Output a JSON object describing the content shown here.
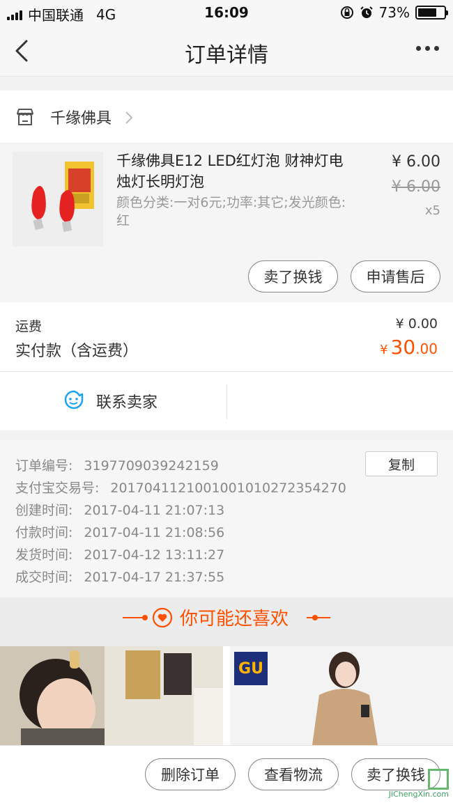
{
  "status_bar": {
    "carrier": "中国联通",
    "network": "4G",
    "time": "16:09",
    "battery": "73%",
    "battery_level": 0.73
  },
  "nav": {
    "title": "订单详情",
    "back_icon": "chevron-left-icon",
    "more_icon": "more-dots-icon"
  },
  "shop": {
    "name": "千缘佛具",
    "icon": "store-icon"
  },
  "product": {
    "name": "千缘佛具E12 LED红灯泡 财神灯电烛灯长明灯泡",
    "spec": "颜色分类:一对6元;功率:其它;发光颜色:红",
    "price": "¥ 6.00",
    "original_price": "¥ 6.00",
    "quantity": "x5",
    "actions": [
      "卖了换钱",
      "申请售后"
    ]
  },
  "fees": {
    "shipping_label": "运费",
    "shipping_value": "¥ 0.00",
    "paid_label": "实付款（含运费）",
    "paid_currency": "¥",
    "paid_int": "30",
    "paid_dec": ".00"
  },
  "contact": {
    "label": "联系卖家"
  },
  "order_info": {
    "copy_label": "复制",
    "rows": [
      {
        "label": "订单编号:",
        "value": "3197709039242159"
      },
      {
        "label": "支付宝交易号:",
        "value": "2017041121001001010272354270"
      },
      {
        "label": "创建时间:",
        "value": "2017-04-11 21:07:13"
      },
      {
        "label": "付款时间:",
        "value": "2017-04-11 21:08:56"
      },
      {
        "label": "发货时间:",
        "value": "2017-04-12 13:11:27"
      },
      {
        "label": "成交时间:",
        "value": "2017-04-17 21:37:55"
      }
    ]
  },
  "recommend": {
    "title": "你可能还喜欢",
    "brand": "GU"
  },
  "bottom_actions": [
    "删除订单",
    "查看物流",
    "卖了换钱"
  ],
  "watermark": {
    "text": "JiChengXin.com"
  },
  "colors": {
    "accent": "#ff5000",
    "contact_icon": "#1aa3f0"
  }
}
